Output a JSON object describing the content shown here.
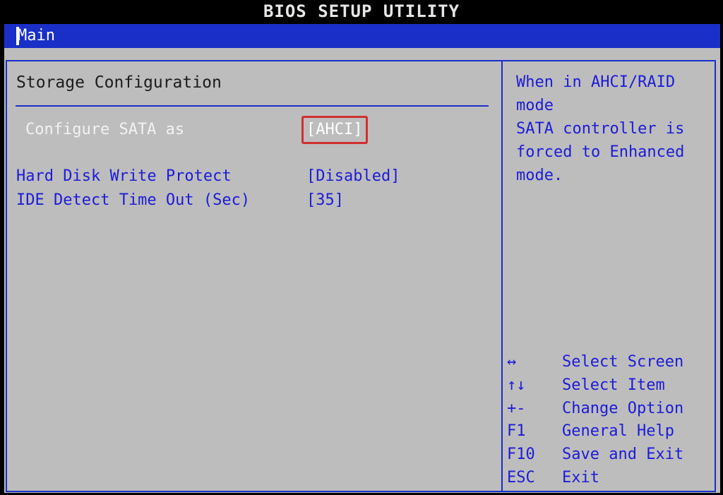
{
  "title": "BIOS SETUP UTILITY",
  "menu": {
    "tabs": [
      {
        "label": "Main"
      }
    ]
  },
  "main": {
    "section_title": "Storage Configuration",
    "settings": [
      {
        "label": "Configure SATA as",
        "value": "[AHCI]",
        "state": "selected"
      },
      {
        "label": "Hard Disk Write Protect",
        "value": "[Disabled]",
        "state": "normal"
      },
      {
        "label": "IDE Detect Time Out (Sec)",
        "value": "[35]",
        "state": "normal"
      }
    ]
  },
  "help": {
    "text": "When in AHCI/RAID mode\nSATA controller is\nforced to Enhanced\nmode."
  },
  "keys": [
    {
      "key": "↔",
      "desc": "Select Screen"
    },
    {
      "key": "↑↓",
      "desc": "Select Item"
    },
    {
      "key": "+-",
      "desc": "Change Option"
    },
    {
      "key": "F1",
      "desc": "General Help"
    },
    {
      "key": "F10",
      "desc": "Save and Exit"
    },
    {
      "key": "ESC",
      "desc": "Exit"
    }
  ],
  "colors": {
    "background": "#bdbdbd",
    "accent_blue": "#1a2fc7",
    "text_blue": "#1c1cd8",
    "highlight_red": "#d03030"
  }
}
